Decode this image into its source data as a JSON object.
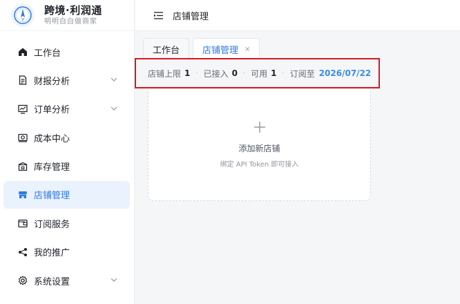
{
  "brand": {
    "name": "跨境·利润通",
    "tagline": "明明白白做商家",
    "logo_icon": "compass-logo-icon",
    "accent_color": "#2f7ae5"
  },
  "sidebar": {
    "items": [
      {
        "label": "工作台",
        "icon": "home-icon",
        "active": false,
        "has_submenu": false
      },
      {
        "label": "财报分析",
        "icon": "report-doc-icon",
        "active": false,
        "has_submenu": true
      },
      {
        "label": "订单分析",
        "icon": "chart-board-icon",
        "active": false,
        "has_submenu": true
      },
      {
        "label": "成本中心",
        "icon": "camera-icon",
        "active": false,
        "has_submenu": false
      },
      {
        "label": "库存管理",
        "icon": "box-icon",
        "active": false,
        "has_submenu": false
      },
      {
        "label": "店铺管理",
        "icon": "shop-icon",
        "active": true,
        "has_submenu": false
      },
      {
        "label": "订阅服务",
        "icon": "wallet-icon",
        "active": false,
        "has_submenu": false
      },
      {
        "label": "我的推广",
        "icon": "share-icon",
        "active": false,
        "has_submenu": false
      },
      {
        "label": "系统设置",
        "icon": "gear-icon",
        "active": false,
        "has_submenu": true
      }
    ]
  },
  "header": {
    "toggle_icon": "menu-fold-icon",
    "title": "店铺管理"
  },
  "tabs": [
    {
      "label": "工作台",
      "active": false,
      "closable": false
    },
    {
      "label": "店铺管理",
      "active": true,
      "closable": true,
      "close_glyph": "×"
    }
  ],
  "stats": {
    "limit_label": "店铺上限",
    "limit_value": "1",
    "connected_label": "已接入",
    "connected_value": "0",
    "available_label": "可用",
    "available_value": "1",
    "subscribe_label": "订阅至",
    "subscribe_date": "2026/07/22",
    "separator": "·",
    "highlight_color": "#d9161c"
  },
  "add_card": {
    "icon": "plus-icon",
    "title": "添加新店铺",
    "subtitle": "绑定 API Token 即可接入"
  }
}
